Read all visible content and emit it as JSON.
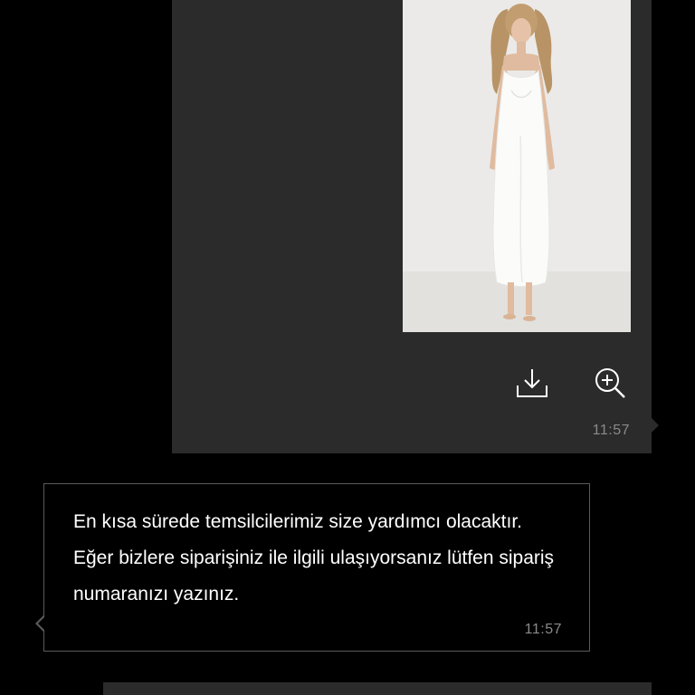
{
  "messages": [
    {
      "direction": "outgoing",
      "attachment": {
        "type": "image",
        "description_icon": "photo-of-woman-in-white-slip-dress"
      },
      "actions": [
        {
          "icon": "download-icon"
        },
        {
          "icon": "zoom-in-icon"
        }
      ],
      "time": "11:57"
    },
    {
      "direction": "incoming",
      "text": "En kısa sürede temsilcilerimiz size yardımcı olacaktır. Eğer bizlere siparişiniz ile ilgili ulaşıyorsanız lütfen sipariş numaranızı yazınız.",
      "time": "11:57"
    }
  ],
  "colors": {
    "background": "#000000",
    "outgoing_bubble": "#2b2b2b",
    "incoming_border": "#5a5a5a",
    "timestamp": "#8a8a8a",
    "text": "#ffffff"
  }
}
